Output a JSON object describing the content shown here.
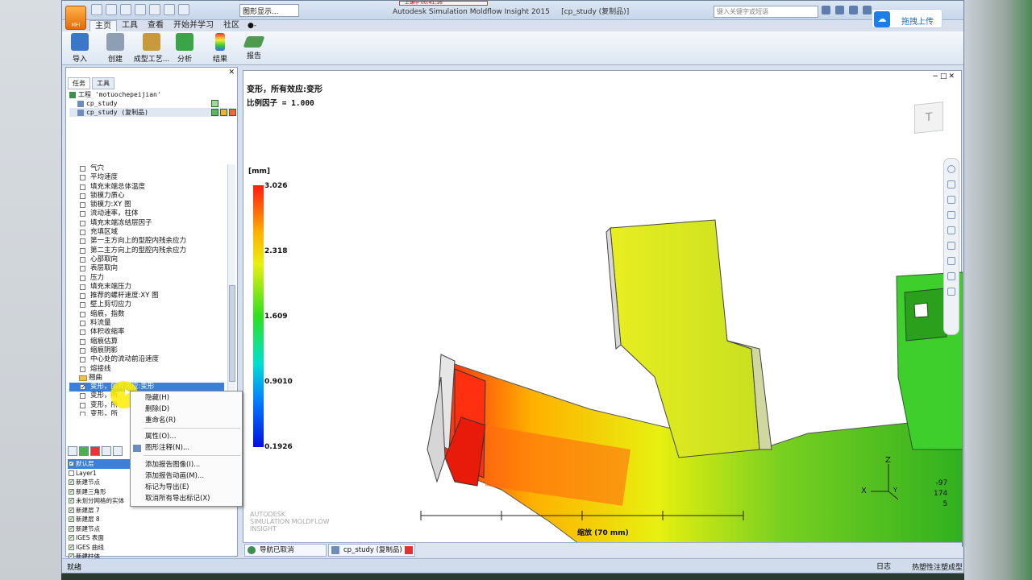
{
  "titlebar": {
    "title": "Autodesk Simulation Moldflow Insight 2015",
    "doc": "[cp_study (复制品)]",
    "view_select": "图形显示...",
    "search_placeholder": "键入关键字或短语",
    "rec_label": "上课中 00:41:16"
  },
  "app_menu": {
    "label": "MFI"
  },
  "upload_button": {
    "label": "拖拽上传"
  },
  "tabs": [
    {
      "label": "主页"
    },
    {
      "label": "工具"
    },
    {
      "label": "查看"
    },
    {
      "label": "开始并学习"
    },
    {
      "label": "社区"
    }
  ],
  "tab_extra": "●-",
  "ribbon": [
    {
      "label": "导入",
      "color": "#3b77c9"
    },
    {
      "label": "创建",
      "color": "#8f9fb3"
    },
    {
      "label": "成型工艺...",
      "color": "#c99a3b"
    },
    {
      "label": "分析",
      "color": "#3aa548"
    },
    {
      "label": "结果",
      "color": "#e05a2a"
    },
    {
      "label": "报告",
      "color": "#4f9a4f"
    }
  ],
  "panel": {
    "close": "✕",
    "tabs": [
      {
        "label": "任务"
      },
      {
        "label": "工具"
      }
    ],
    "project": {
      "root": "工程 'motuochepeijian'",
      "items": [
        "cp_study",
        "cp_study (复制品)"
      ]
    },
    "tree": [
      "气穴",
      "平均速度",
      "填充末端总体温度",
      "锁模力质心",
      "锁模力:XY 图",
      "流动速率，柱体",
      "填充末端冻结层因子",
      "充填区域",
      "第一主方向上的型腔内残余应力",
      "第二主方向上的型腔内残余应力",
      "心部取向",
      "表层取向",
      "压力",
      "填充末端压力",
      "推荐的螺杆速度:XY 图",
      "壁上剪切应力",
      "缩痕，指数",
      "料流量",
      "体积收缩率",
      "缩痕估算",
      "缩痕阴影",
      "中心处的流动前沿速度",
      "熔接线"
    ],
    "folder": "翘曲",
    "warp_items": [
      {
        "label": "变形，所有效应:变形",
        "checked": true
      },
      {
        "label": "变形，所",
        "checked": false
      },
      {
        "label": "变形，所",
        "checked": false
      },
      {
        "label": "变形，所",
        "checked": false
      }
    ],
    "layers": [
      {
        "label": "默认层",
        "checked": true
      },
      {
        "label": "Layer1",
        "checked": false
      },
      {
        "label": "新建节点",
        "checked": true
      },
      {
        "label": "新建三角形",
        "checked": true
      },
      {
        "label": "未划分网格的实体",
        "checked": true
      },
      {
        "label": "新建层 7",
        "checked": true
      },
      {
        "label": "新建层 8",
        "checked": true
      },
      {
        "label": "新建节点",
        "checked": true
      },
      {
        "label": "IGES 表面",
        "checked": true
      },
      {
        "label": "IGES 曲线",
        "checked": true
      },
      {
        "label": "新建柱体",
        "checked": true
      }
    ]
  },
  "context_menu": {
    "items": [
      {
        "label": "隐藏(H)"
      },
      {
        "label": "删除(D)"
      },
      {
        "label": "重命名(R)"
      },
      {
        "label": "属性(O)..."
      },
      {
        "label": "图形注释(N)..."
      },
      {
        "label": "添加报告图像(I)..."
      },
      {
        "label": "添加报告动画(M)..."
      },
      {
        "label": "标记为导出(E)"
      },
      {
        "label": "取消所有导出标记(X)"
      }
    ]
  },
  "graphics": {
    "title": "变形，所有效应:变形",
    "scale": "比例因子 = 1.000",
    "win_controls": "−□✕",
    "unit": "[mm]",
    "legend": [
      "3.026",
      "2.318",
      "1.609",
      "0.9010",
      "0.1926"
    ],
    "navcube_face": "T",
    "axis_z": "Z",
    "axis_x": "X",
    "axis_y": "Y",
    "coords": [
      "-97",
      "174",
      "5"
    ],
    "ruler": "缩放 (70 mm)",
    "watermark": [
      "AUTODESK",
      "SIMULATION MOLDFLOW",
      "INSIGHT"
    ]
  },
  "doc_tabs": [
    {
      "label": "导航已取消"
    },
    {
      "label": "cp_study (复制品)"
    }
  ],
  "status": {
    "left": "就绪",
    "log": "日志",
    "mode": "热塑性注塑成型"
  }
}
